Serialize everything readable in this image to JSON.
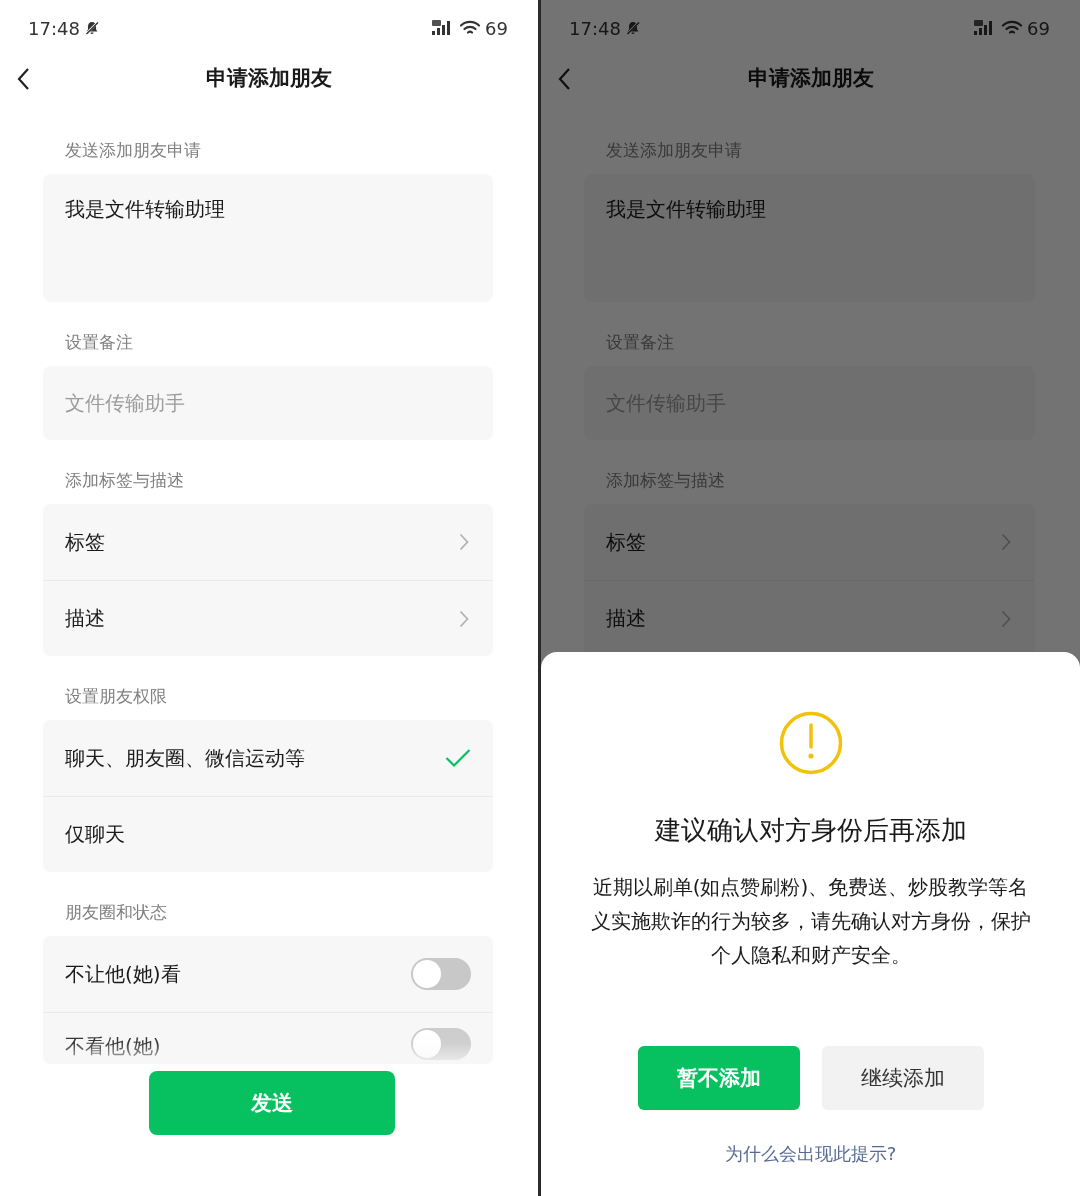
{
  "screens": [
    {
      "status_bar": {
        "time": "17:48",
        "battery": "69"
      },
      "title": "申请添加朋友",
      "dimmed": false,
      "sections": [
        {
          "heading": "发送添加朋友申请",
          "kind": "textarea",
          "value": "我是文件转输助理"
        },
        {
          "heading": "设置备注",
          "kind": "input",
          "placeholder": "文件传输助手"
        },
        {
          "heading": "添加标签与描述",
          "kind": "rows",
          "items": [
            {
              "label": "标签",
              "kind": "link"
            },
            {
              "label": "描述",
              "kind": "link"
            }
          ]
        },
        {
          "heading": "设置朋友权限",
          "kind": "rows",
          "items": [
            {
              "label": "聊天、朋友圈、微信运动等",
              "kind": "option",
              "selected": true
            },
            {
              "label": "仅聊天",
              "kind": "option",
              "selected": false
            }
          ]
        },
        {
          "heading": "朋友圈和状态",
          "kind": "rows",
          "items": [
            {
              "label": "不让他(她)看",
              "kind": "toggle",
              "on": false
            },
            {
              "label": "不看他(她)",
              "kind": "toggle",
              "on": false,
              "faded": true
            }
          ]
        }
      ],
      "send_button": "发送"
    },
    {
      "status_bar": {
        "time": "17:48",
        "battery": "69"
      },
      "title": "申请添加朋友",
      "dimmed": true,
      "sections": [
        {
          "heading": "发送添加朋友申请",
          "kind": "textarea",
          "value": "我是文件转输助理"
        },
        {
          "heading": "设置备注",
          "kind": "input",
          "placeholder": "文件传输助手"
        },
        {
          "heading": "添加标签与描述",
          "kind": "rows",
          "items": [
            {
              "label": "标签",
              "kind": "link"
            },
            {
              "label": "描述",
              "kind": "link"
            }
          ]
        }
      ],
      "dialog": {
        "title": "建议确认对方身份后再添加",
        "message": "近期以刷单(如点赞刷粉)、免费送、炒股教学等名义实施欺诈的行为较多，请先确认对方身份，保护个人隐私和财产安全。",
        "buttons": [
          {
            "label": "暂不添加",
            "kind": "primary"
          },
          {
            "label": "继续添加",
            "kind": "secondary"
          }
        ],
        "link": "为什么会出现此提示?"
      }
    }
  ]
}
